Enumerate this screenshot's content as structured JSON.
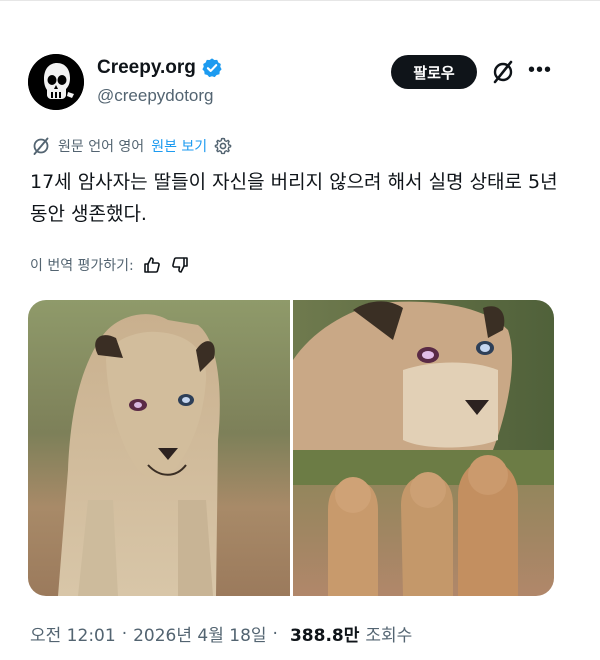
{
  "author": {
    "display_name": "Creepy.org",
    "handle": "@creepydotorg",
    "avatar_icon": "skull-icon",
    "verified": true,
    "verified_color": "#1d9bf0"
  },
  "header": {
    "follow_label": "팔로우",
    "grok_icon": "grok-icon",
    "more_icon": "more-icon"
  },
  "translation": {
    "label": "원문 언어 영어",
    "show_original": "원본 보기",
    "settings_icon": "gear-icon"
  },
  "tweet": {
    "text": "17세 암사자는 딸들이 자신을 버리지 않으려 해서 실명 상태로 5년 동안 생존했다."
  },
  "rating": {
    "label": "이 번역 평가하기:",
    "like_icon": "thumbs-up-icon",
    "dislike_icon": "thumbs-down-icon"
  },
  "media": {
    "left_image": "lioness-portrait-photo",
    "right_image": "lioness-closeup-and-three-lionesses-photo"
  },
  "footer": {
    "time": "오전 12:01",
    "date": "2026년 4월 18일",
    "separator": "·",
    "views_count": "388.8만",
    "views_label": "조회수"
  },
  "colors": {
    "text": "#0f1419",
    "muted": "#536471",
    "link": "#1d9bf0"
  }
}
